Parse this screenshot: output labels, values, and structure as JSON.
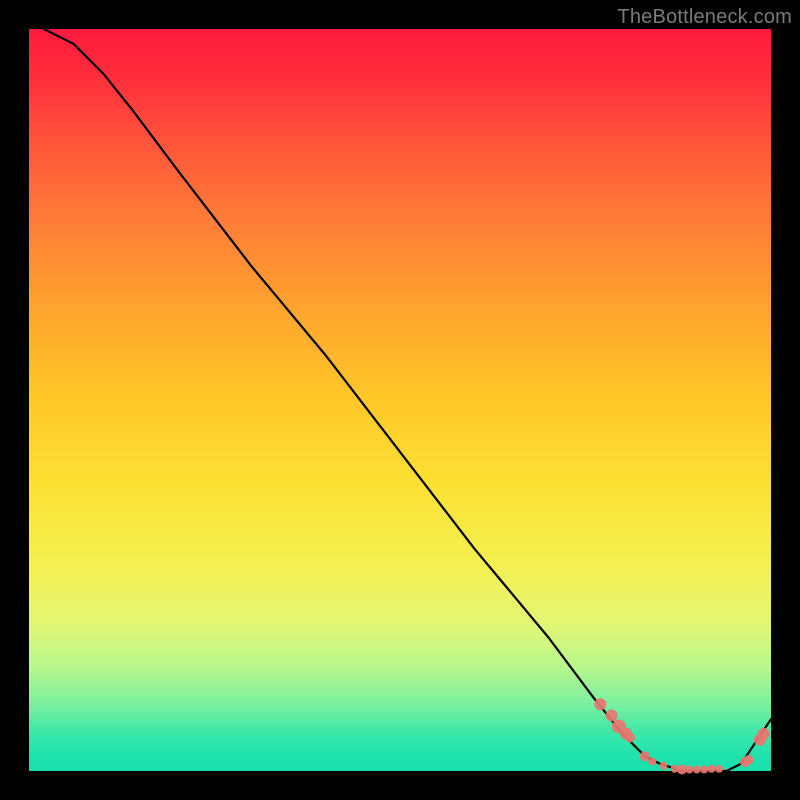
{
  "watermark": "TheBottleneck.com",
  "colors": {
    "frame": "#000000",
    "line": "#000000",
    "marker": "#e9766e",
    "gradient_top": "#ff1a3e",
    "gradient_bottom": "#1adfae"
  },
  "chart_data": {
    "type": "line",
    "title": "",
    "xlabel": "",
    "ylabel": "",
    "xlim": [
      0,
      100
    ],
    "ylim": [
      0,
      100
    ],
    "grid": false,
    "legend": false,
    "series": [
      {
        "name": "curve",
        "x": [
          2,
          6,
          10,
          14,
          20,
          30,
          40,
          50,
          60,
          70,
          76,
          80,
          83,
          85,
          88,
          90,
          92,
          94,
          96,
          98,
          100
        ],
        "y": [
          100,
          98,
          94,
          89,
          81,
          68,
          56,
          43,
          30,
          18,
          10,
          5,
          2,
          1,
          0,
          0,
          0,
          0,
          1,
          4,
          7
        ]
      }
    ],
    "markers": {
      "name": "dots",
      "x": [
        77,
        78.5,
        79.5,
        80.5,
        81,
        83,
        84,
        85.5,
        87,
        88,
        89,
        90,
        91,
        92,
        93,
        96.5,
        97,
        98.5,
        99
      ],
      "y": [
        9,
        7.5,
        6,
        5,
        4.5,
        2,
        1.3,
        0.7,
        0.3,
        0.2,
        0.2,
        0.2,
        0.2,
        0.3,
        0.3,
        1.2,
        1.5,
        4.2,
        5
      ],
      "r": [
        6,
        6,
        7,
        6,
        5,
        5,
        4,
        4,
        4,
        5,
        4,
        4,
        4,
        4,
        4,
        5,
        5,
        6,
        6
      ]
    }
  }
}
